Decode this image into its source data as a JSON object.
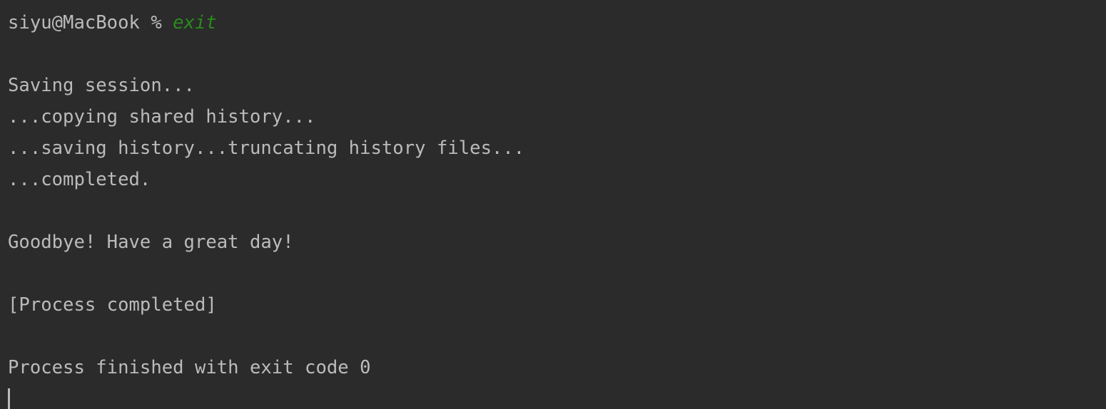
{
  "terminal": {
    "prompt": "siyu@MacBook % ",
    "command": "exit",
    "lines": [
      "",
      "Saving session...",
      "...copying shared history...",
      "...saving history...truncating history files...",
      "...completed.",
      "",
      "Goodbye! Have a great day!",
      "",
      "[Process completed]",
      "",
      "Process finished with exit code 0"
    ]
  },
  "colors": {
    "background": "#2b2b2b",
    "text": "#bbbbbb",
    "command": "#2b8a1e"
  }
}
